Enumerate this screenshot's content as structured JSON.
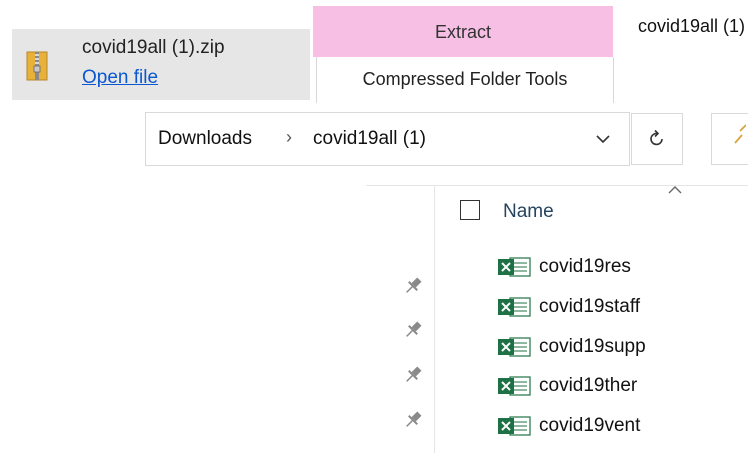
{
  "download_bar": {
    "file_name": "covid19all (1).zip",
    "open_link": "Open file"
  },
  "ribbon": {
    "context_tab": "Extract",
    "context_group": "Compressed Folder Tools",
    "window_title": "covid19all (1)",
    "context_color": "#f7bfe3"
  },
  "address_bar": {
    "crumbs": [
      "Downloads",
      "covid19all (1)"
    ],
    "separator": "›"
  },
  "file_list": {
    "column_name": "Name",
    "files": [
      {
        "name": "covid19res",
        "icon": "excel-file-icon"
      },
      {
        "name": "covid19staff",
        "icon": "excel-file-icon"
      },
      {
        "name": "covid19supp",
        "icon": "excel-file-icon"
      },
      {
        "name": "covid19ther",
        "icon": "excel-file-icon"
      },
      {
        "name": "covid19vent",
        "icon": "excel-file-icon"
      }
    ]
  }
}
